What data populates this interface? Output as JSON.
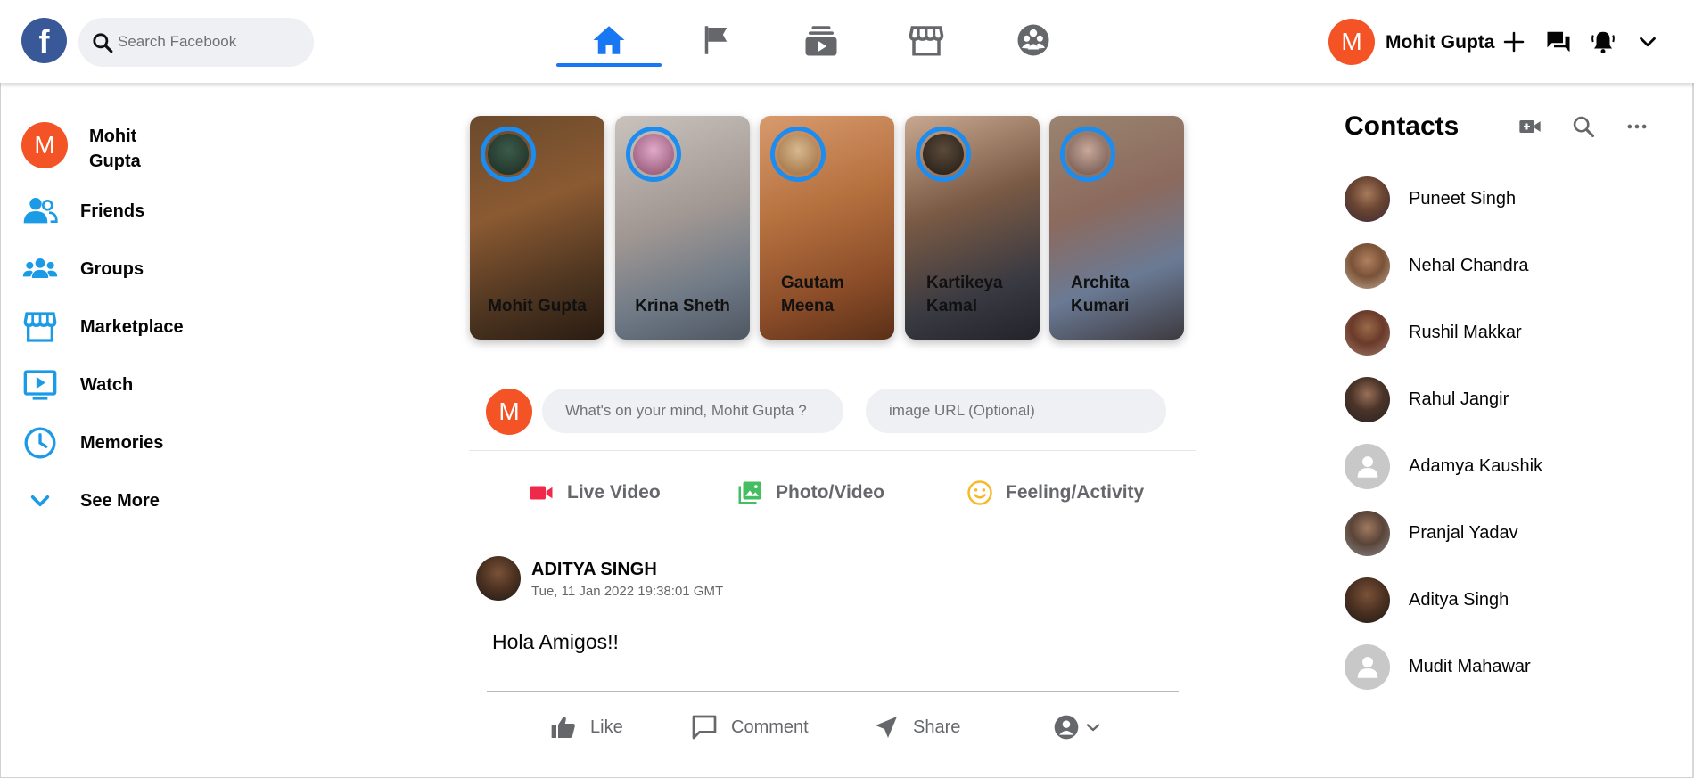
{
  "header": {
    "logo_letter": "f",
    "search": {
      "placeholder": "Search Facebook"
    },
    "nav_tabs": [
      {
        "name": "home",
        "icon": "home-icon",
        "active": true
      },
      {
        "name": "pages",
        "icon": "flag-icon",
        "active": false
      },
      {
        "name": "watch",
        "icon": "video-stack-icon",
        "active": false
      },
      {
        "name": "marketplace",
        "icon": "store-icon",
        "active": false
      },
      {
        "name": "groups",
        "icon": "group-circle-icon",
        "active": false
      }
    ],
    "user": {
      "initial": "M",
      "name": "Mohit Gupta"
    },
    "buttons": [
      "plus-icon",
      "messenger-icon",
      "bell-icon",
      "chevron-down-icon"
    ]
  },
  "sidebar": {
    "profile": {
      "initial": "M",
      "name": "Mohit Gupta"
    },
    "items": [
      {
        "label": "Friends",
        "icon": "friends-icon"
      },
      {
        "label": "Groups",
        "icon": "groups-icon"
      },
      {
        "label": "Marketplace",
        "icon": "marketplace-icon"
      },
      {
        "label": "Watch",
        "icon": "watch-icon"
      },
      {
        "label": "Memories",
        "icon": "clock-icon"
      },
      {
        "label": "See More",
        "icon": "chevron-down-icon"
      }
    ]
  },
  "stories": [
    {
      "name": "Mohit Gupta"
    },
    {
      "name": "Krina Sheth"
    },
    {
      "name": "Gautam Meena"
    },
    {
      "name": "Kartikeya Kamal"
    },
    {
      "name": "Archita Kumari"
    }
  ],
  "composer": {
    "initial": "M",
    "message_placeholder": "What's on your mind, Mohit Gupta ?",
    "image_placeholder": "image URL (Optional)",
    "actions": [
      {
        "label": "Live Video",
        "icon": "video-camera-icon",
        "color": "#f02849"
      },
      {
        "label": "Photo/Video",
        "icon": "photo-icon",
        "color": "#45bd62"
      },
      {
        "label": "Feeling/Activity",
        "icon": "smiley-icon",
        "color": "#f7b928"
      }
    ]
  },
  "post": {
    "author": "ADITYA SINGH",
    "timestamp": "Tue, 11 Jan 2022 19:38:01 GMT",
    "text": "Hola Amigos!!",
    "actions": [
      {
        "label": "Like",
        "icon": "thumbs-up-icon"
      },
      {
        "label": "Comment",
        "icon": "comment-icon"
      },
      {
        "label": "Share",
        "icon": "share-arrow-icon"
      }
    ]
  },
  "contacts": {
    "title": "Contacts",
    "tools": [
      "new-room-icon",
      "search-icon",
      "more-icon"
    ],
    "people": [
      {
        "name": "Puneet Singh"
      },
      {
        "name": "Nehal Chandra"
      },
      {
        "name": "Rushil Makkar"
      },
      {
        "name": "Rahul Jangir"
      },
      {
        "name": "Adamya Kaushik"
      },
      {
        "name": "Pranjal Yadav"
      },
      {
        "name": "Aditya Singh"
      },
      {
        "name": "Mudit Mahawar"
      }
    ]
  },
  "colors": {
    "brand": "#1877f2",
    "avatar_orange": "#f35325",
    "icon_blue": "#1b9ae6",
    "secondary_text": "#65676b"
  }
}
